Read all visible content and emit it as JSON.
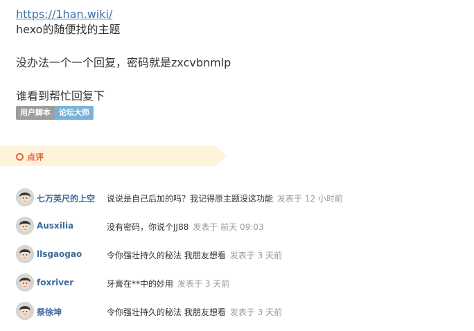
{
  "post": {
    "link": "https://1han.wiki/",
    "line1": "hexo的随便找的主题",
    "line2": "没办法一个一个回复，密码就是zxcvbnmlp",
    "line3": "谁看到帮忙回复下"
  },
  "tags": [
    "用户脚本",
    "论坛大师"
  ],
  "section": {
    "title": "点评"
  },
  "comments": [
    {
      "author": "七万英尺的上空",
      "text": "说说是自己后加的吗？我记得原主题没这功能",
      "time": "发表于 12 小时前"
    },
    {
      "author": "Ausxilia",
      "text": "没有密码，你说个JJ88",
      "time": "发表于 前天 09:03"
    },
    {
      "author": "llsgaogao",
      "text": "令你强壮持久的秘法 我朋友想看",
      "time": "发表于 3 天前"
    },
    {
      "author": "foxriver",
      "text": "牙膏在**中的妙用",
      "time": "发表于 3 天前"
    },
    {
      "author": "祭徐坤",
      "text": "令你强壮持久的秘法 我朋友想看",
      "time": "发表于 3 天前"
    }
  ]
}
